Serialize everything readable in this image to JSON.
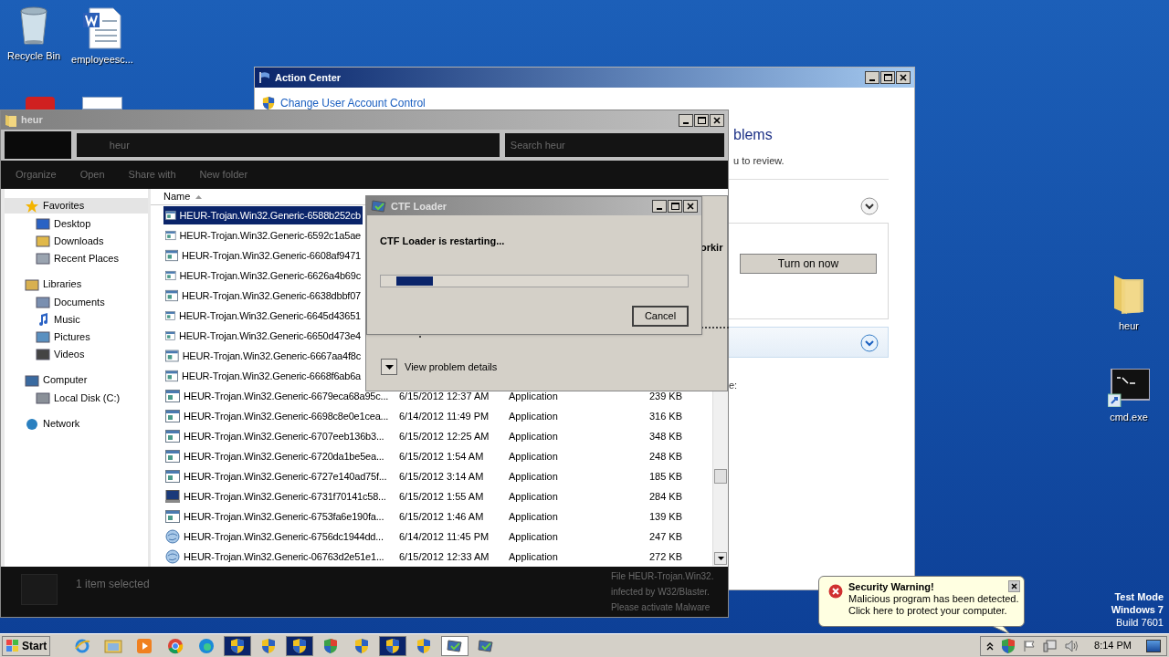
{
  "desktop_icons": [
    {
      "label": "Recycle Bin",
      "kind": "recycle"
    },
    {
      "label": "employeesc...",
      "kind": "document"
    },
    {
      "label": "heur",
      "kind": "folder"
    },
    {
      "label": "cmd.exe",
      "kind": "console"
    }
  ],
  "action_center": {
    "title": "Action Center",
    "link": "Change User Account Control",
    "heading": "blems",
    "subtitle": "u to review.",
    "button": "Turn on now",
    "footer_text": "e:"
  },
  "explorer": {
    "title": "heur",
    "address": "heur",
    "search_placeholder": "Search heur",
    "toolbar": [
      "Organize",
      "Open",
      "Share with",
      "New folder"
    ],
    "sidebar": [
      {
        "label": "Favorites",
        "kind": "star",
        "selected": true,
        "children": [
          {
            "label": "Desktop",
            "kind": "desktop"
          },
          {
            "label": "Downloads",
            "kind": "downloads"
          },
          {
            "label": "Recent Places",
            "kind": "recent"
          }
        ]
      },
      {
        "label": "Libraries",
        "kind": "library",
        "selected": false,
        "children": [
          {
            "label": "Documents",
            "kind": "documents"
          },
          {
            "label": "Music",
            "kind": "music"
          },
          {
            "label": "Pictures",
            "kind": "pictures"
          },
          {
            "label": "Videos",
            "kind": "videos"
          }
        ]
      },
      {
        "label": "Computer",
        "kind": "computer",
        "selected": false,
        "children": [
          {
            "label": "Local Disk (C:)",
            "kind": "disk"
          }
        ]
      },
      {
        "label": "Network",
        "kind": "network",
        "selected": false
      }
    ],
    "column": "Name",
    "rows": [
      {
        "name": "HEUR-Trojan.Win32.Generic-6588b252cb",
        "selected": true,
        "kind": "app"
      },
      {
        "name": "HEUR-Trojan.Win32.Generic-6592c1a5ae",
        "selected": false,
        "kind": "app"
      },
      {
        "name": "HEUR-Trojan.Win32.Generic-6608af9471",
        "selected": false,
        "kind": "app"
      },
      {
        "name": "HEUR-Trojan.Win32.Generic-6626a4b69c",
        "selected": false,
        "kind": "app"
      },
      {
        "name": "HEUR-Trojan.Win32.Generic-6638dbbf07",
        "selected": false,
        "kind": "app"
      },
      {
        "name": "HEUR-Trojan.Win32.Generic-6645d43651",
        "selected": false,
        "kind": "app"
      },
      {
        "name": "HEUR-Trojan.Win32.Generic-6650d473e4",
        "selected": false,
        "kind": "app"
      },
      {
        "name": "HEUR-Trojan.Win32.Generic-6667aa4f8c",
        "selected": false,
        "kind": "app"
      },
      {
        "name": "HEUR-Trojan.Win32.Generic-6668f6ab6a",
        "selected": false,
        "kind": "app"
      },
      {
        "name": "HEUR-Trojan.Win32.Generic-6679eca68a95c...",
        "date": "6/15/2012 12:37 AM",
        "type": "Application",
        "size": "239 KB",
        "selected": false,
        "kind": "app"
      },
      {
        "name": "HEUR-Trojan.Win32.Generic-6698c8e0e1cea...",
        "date": "6/14/2012 11:49 PM",
        "type": "Application",
        "size": "316 KB",
        "selected": false,
        "kind": "app"
      },
      {
        "name": "HEUR-Trojan.Win32.Generic-6707eeb136b3...",
        "date": "6/15/2012 12:25 AM",
        "type": "Application",
        "size": "348 KB",
        "selected": false,
        "kind": "app"
      },
      {
        "name": "HEUR-Trojan.Win32.Generic-6720da1be5ea...",
        "date": "6/15/2012 1:54 AM",
        "type": "Application",
        "size": "248 KB",
        "selected": false,
        "kind": "app"
      },
      {
        "name": "HEUR-Trojan.Win32.Generic-6727e140ad75f...",
        "date": "6/15/2012 3:14 AM",
        "type": "Application",
        "size": "185 KB",
        "selected": false,
        "kind": "app"
      },
      {
        "name": "HEUR-Trojan.Win32.Generic-6731f70141c58...",
        "date": "6/15/2012 1:55 AM",
        "type": "Application",
        "size": "284 KB",
        "selected": false,
        "kind": "monitor"
      },
      {
        "name": "HEUR-Trojan.Win32.Generic-6753fa6e190fa...",
        "date": "6/15/2012 1:46 AM",
        "type": "Application",
        "size": "139 KB",
        "selected": false,
        "kind": "app"
      },
      {
        "name": "HEUR-Trojan.Win32.Generic-6756dc1944dd...",
        "date": "6/14/2012 11:45 PM",
        "type": "Application",
        "size": "247 KB",
        "selected": false,
        "kind": "globe"
      },
      {
        "name": "HEUR-Trojan.Win32.Generic-06763d2e51e1...",
        "date": "6/15/2012 12:33 AM",
        "type": "Application",
        "size": "272 KB",
        "selected": false,
        "kind": "globe"
      }
    ],
    "status": "1 item selected",
    "details": [
      "File HEUR-Trojan.Win32.",
      "infected by W32/Blaster.",
      "Please activate Malware"
    ]
  },
  "problem_dialog": {
    "partial_text": "orkir",
    "details_button": "View problem details"
  },
  "ctf_dialog": {
    "title": "CTF Loader",
    "message": "CTF Loader is restarting...",
    "button": "Cancel"
  },
  "balloon": {
    "title": "Security Warning!",
    "lines": [
      "Malicious program has been detected.",
      "Click here to protect your computer."
    ]
  },
  "os_notice": [
    "Test Mode",
    "Windows 7",
    "Build 7601"
  ],
  "taskbar": {
    "start": "Start",
    "clock": "8:14 PM",
    "buttons": [
      {
        "kind": "ie",
        "selected": false
      },
      {
        "kind": "folder",
        "selected": false
      },
      {
        "kind": "media",
        "selected": false
      },
      {
        "kind": "chrome",
        "selected": false
      },
      {
        "kind": "edge",
        "selected": false
      },
      {
        "kind": "shield",
        "selected": true
      },
      {
        "kind": "shield",
        "selected": false
      },
      {
        "kind": "shield",
        "selected": true
      },
      {
        "kind": "colorshield",
        "selected": false
      },
      {
        "kind": "shield",
        "selected": false
      },
      {
        "kind": "shield",
        "selected": true
      },
      {
        "kind": "shield",
        "selected": false
      },
      {
        "kind": "loader",
        "selected": true
      },
      {
        "kind": "loader",
        "selected": false
      }
    ]
  }
}
